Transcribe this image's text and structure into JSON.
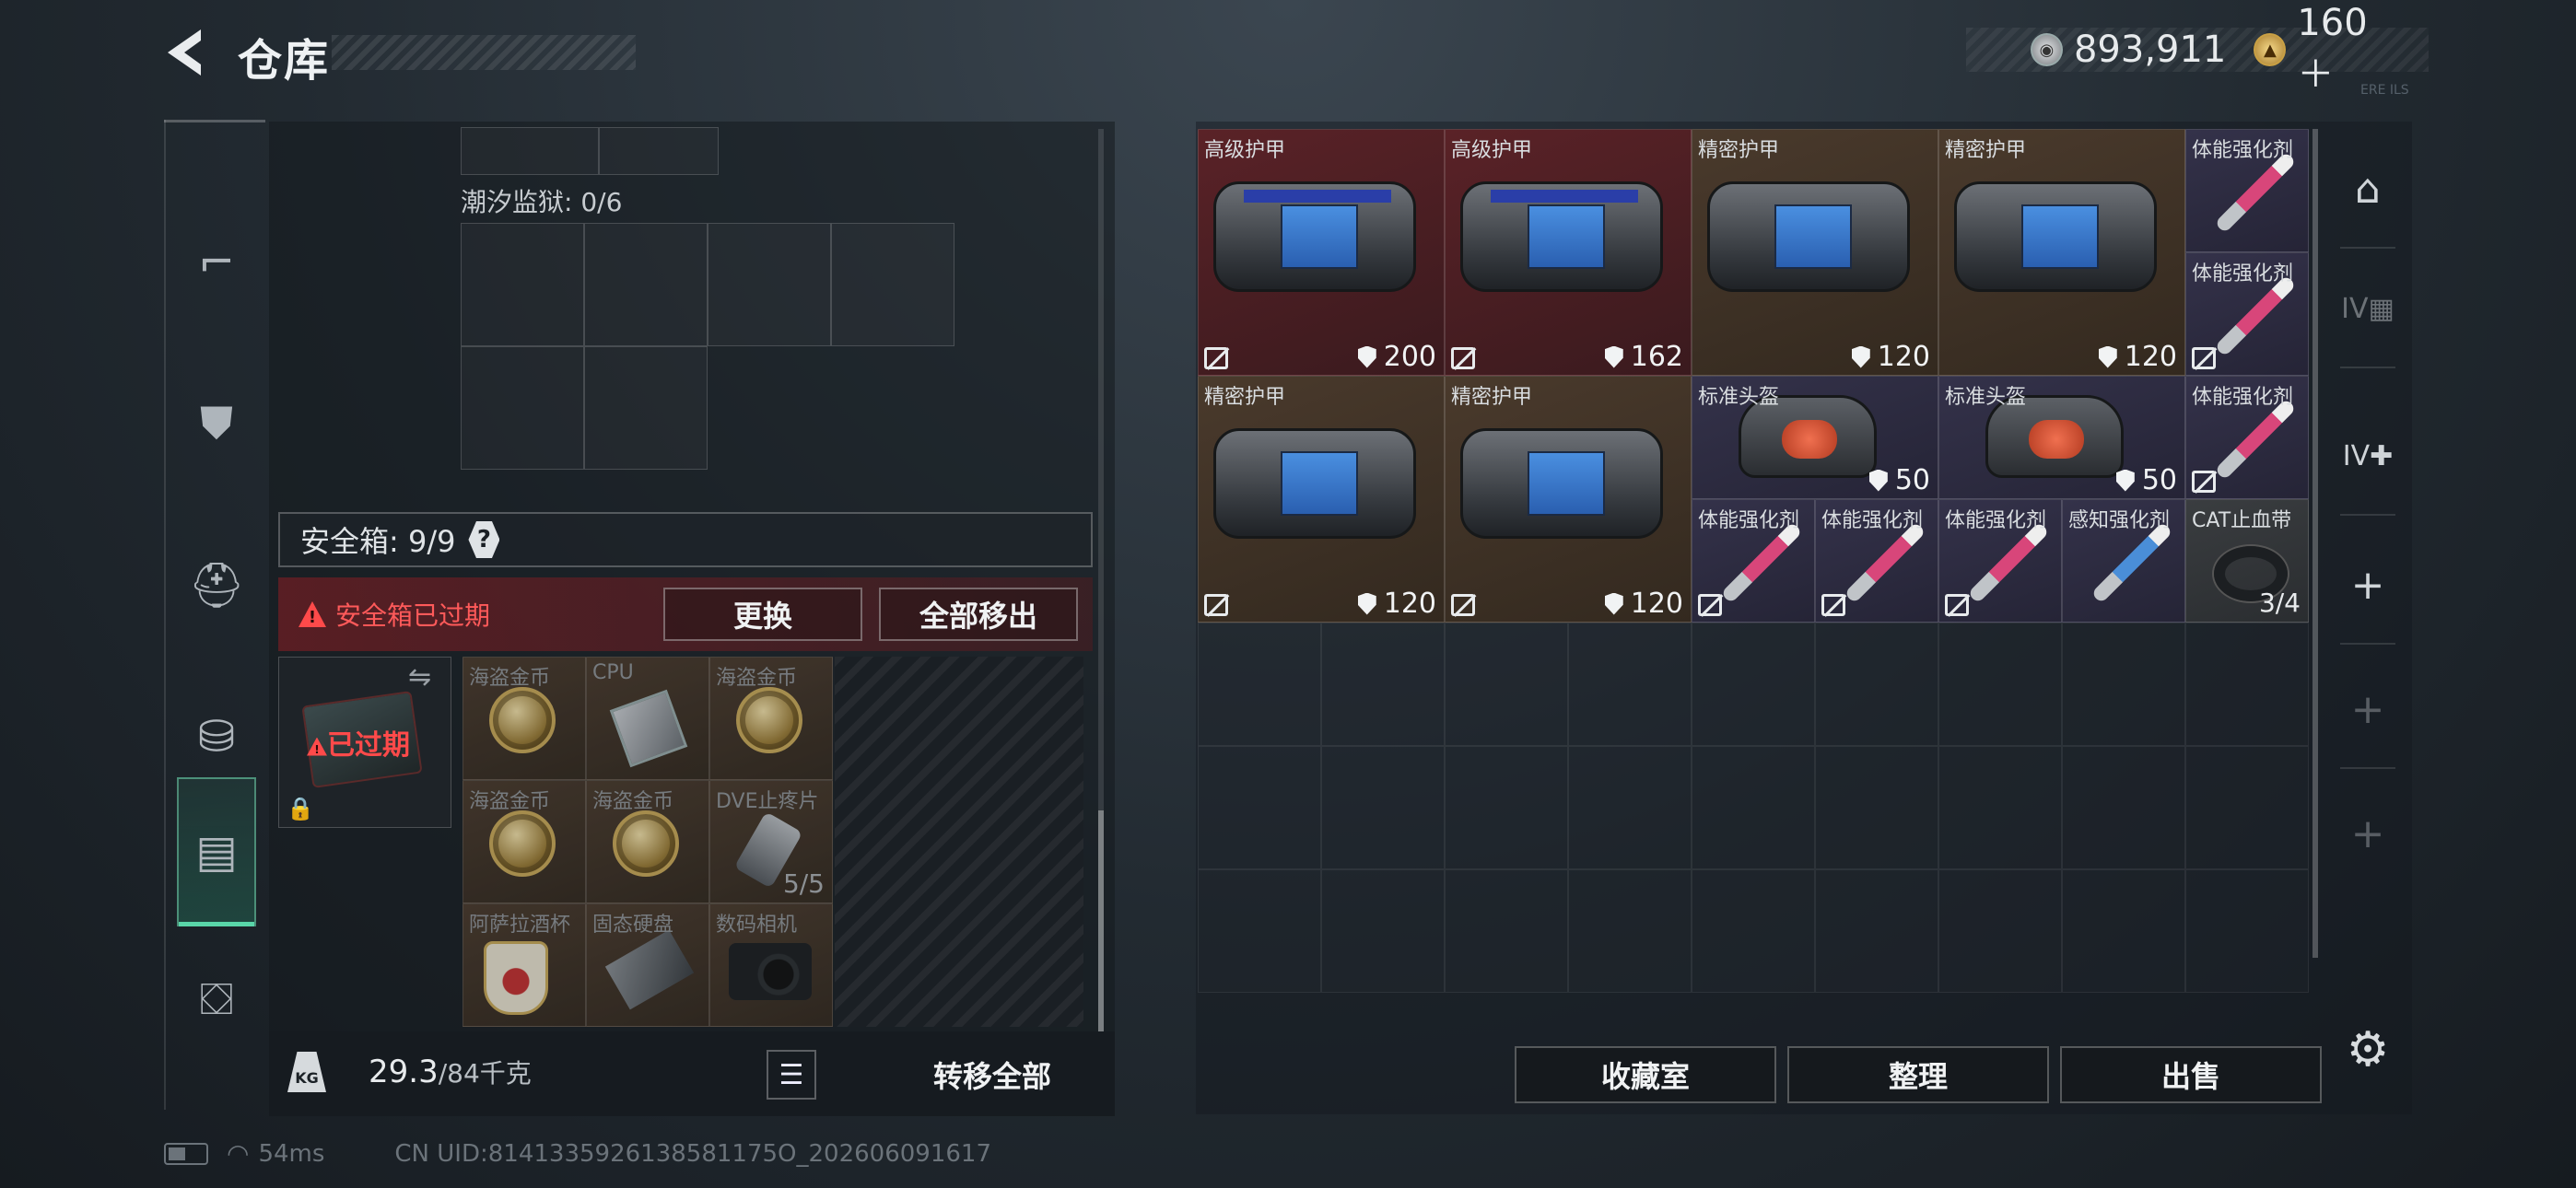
{
  "header": {
    "title": "仓库",
    "back_icon": "back-arrow-icon"
  },
  "currency": [
    {
      "icon": "silver-coin-icon",
      "value": "893,911"
    },
    {
      "icon": "gold-coin-icon",
      "value": "160＋"
    }
  ],
  "top_right_tiny": "ERE ILS",
  "left_rail": [
    {
      "icon": "pistol-icon",
      "glyph": "⌐"
    },
    {
      "icon": "armor-vest-icon",
      "glyph": "⛊"
    },
    {
      "icon": "backpack-icon",
      "glyph": "⛑"
    },
    {
      "icon": "pouch-icon",
      "glyph": "⛁"
    },
    {
      "icon": "case-icon",
      "glyph": "▤"
    },
    {
      "icon": "toolbox-icon",
      "glyph": "⛋"
    }
  ],
  "left_panel": {
    "tide_prison_label": "潮汐监狱: 0/6",
    "safebox": {
      "label": "安全箱: 9/9",
      "help": "?"
    },
    "expired_banner": {
      "text": "安全箱已过期",
      "replace_button": "更换",
      "remove_all_button": "全部移出"
    },
    "safebox_card": {
      "expired_label": "已过期"
    },
    "safe_items": [
      {
        "name": "海盗金币",
        "kind": "coin",
        "col": 0,
        "row": 0
      },
      {
        "name": "CPU",
        "kind": "chip",
        "col": 1,
        "row": 0
      },
      {
        "name": "海盗金币",
        "kind": "coin",
        "col": 2,
        "row": 0
      },
      {
        "name": "海盗金币",
        "kind": "coin",
        "col": 0,
        "row": 1
      },
      {
        "name": "海盗金币",
        "kind": "coin",
        "col": 1,
        "row": 1
      },
      {
        "name": "DVE止疼片",
        "kind": "pill",
        "col": 2,
        "row": 1,
        "qty": "5/5"
      },
      {
        "name": "阿萨拉酒杯",
        "kind": "cup",
        "col": 0,
        "row": 2
      },
      {
        "name": "固态硬盘",
        "kind": "ssd",
        "col": 1,
        "row": 2
      },
      {
        "name": "数码相机",
        "kind": "camera",
        "col": 2,
        "row": 2
      }
    ]
  },
  "footer": {
    "weight_current": "29.3",
    "weight_total": "/84千克",
    "kg_icon": "KG",
    "transfer_all": "转移全部"
  },
  "stash_items": [
    {
      "name": "高级护甲",
      "color": "red",
      "type": "bag",
      "heavy": true,
      "col": 0,
      "row": 0,
      "w": 2,
      "h": 2,
      "dur": "200",
      "notrade": true
    },
    {
      "name": "高级护甲",
      "color": "red",
      "type": "bag",
      "heavy": true,
      "col": 2,
      "row": 0,
      "w": 2,
      "h": 2,
      "dur": "162",
      "notrade": true
    },
    {
      "name": "精密护甲",
      "color": "brown",
      "type": "bag",
      "col": 4,
      "row": 0,
      "w": 2,
      "h": 2,
      "dur": "120"
    },
    {
      "name": "精密护甲",
      "color": "brown",
      "type": "bag",
      "col": 6,
      "row": 0,
      "w": 2,
      "h": 2,
      "dur": "120"
    },
    {
      "name": "体能强化剂",
      "color": "purple",
      "type": "syringe",
      "col": 8,
      "row": 0,
      "w": 1,
      "h": 1
    },
    {
      "name": "体能强化剂",
      "color": "purple",
      "type": "syringe",
      "col": 8,
      "row": 1,
      "w": 1,
      "h": 1,
      "notrade": true
    },
    {
      "name": "精密护甲",
      "color": "brown",
      "type": "bag",
      "col": 0,
      "row": 2,
      "w": 2,
      "h": 2,
      "dur": "120",
      "notrade": true
    },
    {
      "name": "精密护甲",
      "color": "brown",
      "type": "bag",
      "col": 2,
      "row": 2,
      "w": 2,
      "h": 2,
      "dur": "120",
      "notrade": true
    },
    {
      "name": "标准头盔",
      "color": "purple",
      "type": "helmet",
      "col": 4,
      "row": 2,
      "w": 2,
      "h": 1,
      "dur": "50"
    },
    {
      "name": "标准头盔",
      "color": "purple",
      "type": "helmet",
      "col": 6,
      "row": 2,
      "w": 2,
      "h": 1,
      "dur": "50"
    },
    {
      "name": "体能强化剂",
      "color": "purple",
      "type": "syringe",
      "col": 8,
      "row": 2,
      "w": 1,
      "h": 1,
      "notrade": true
    },
    {
      "name": "体能强化剂",
      "color": "purple",
      "type": "syringe",
      "col": 4,
      "row": 3,
      "w": 1,
      "h": 1,
      "notrade": true
    },
    {
      "name": "体能强化剂",
      "color": "purple",
      "type": "syringe",
      "col": 5,
      "row": 3,
      "w": 1,
      "h": 1,
      "notrade": true
    },
    {
      "name": "体能强化剂",
      "color": "purple",
      "type": "syringe",
      "col": 6,
      "row": 3,
      "w": 1,
      "h": 1,
      "notrade": true
    },
    {
      "name": "感知强化剂",
      "color": "purple",
      "type": "syringe-blue",
      "col": 7,
      "row": 3,
      "w": 1,
      "h": 1
    },
    {
      "name": "CAT止血带",
      "color": "grey",
      "type": "tourniquet",
      "col": 8,
      "row": 3,
      "w": 1,
      "h": 1,
      "qty": "3/4"
    }
  ],
  "right_rail": [
    {
      "icon": "safe-house-icon",
      "glyph": "⌂"
    },
    {
      "icon": "storage-expand-icon",
      "glyph": "IV▦"
    },
    {
      "icon": "storage-add-icon",
      "glyph": "IV✚"
    },
    {
      "icon": "add-icon",
      "glyph": "+"
    },
    {
      "icon": "add-icon",
      "glyph": "+"
    },
    {
      "icon": "add-icon",
      "glyph": "+"
    }
  ],
  "bottom_buttons": {
    "collection": "收藏室",
    "sort": "整理",
    "sell": "出售"
  },
  "status": {
    "ping": "54ms",
    "uid": "CN UID:8141335926138581175O_202606091617"
  },
  "colors": {
    "accent": "#59d6a9",
    "expired_red": "#ff4a4a",
    "armor_red": "#5a2227",
    "armor_brown": "#4a3a2c",
    "consumable_purple": "#34324a"
  }
}
